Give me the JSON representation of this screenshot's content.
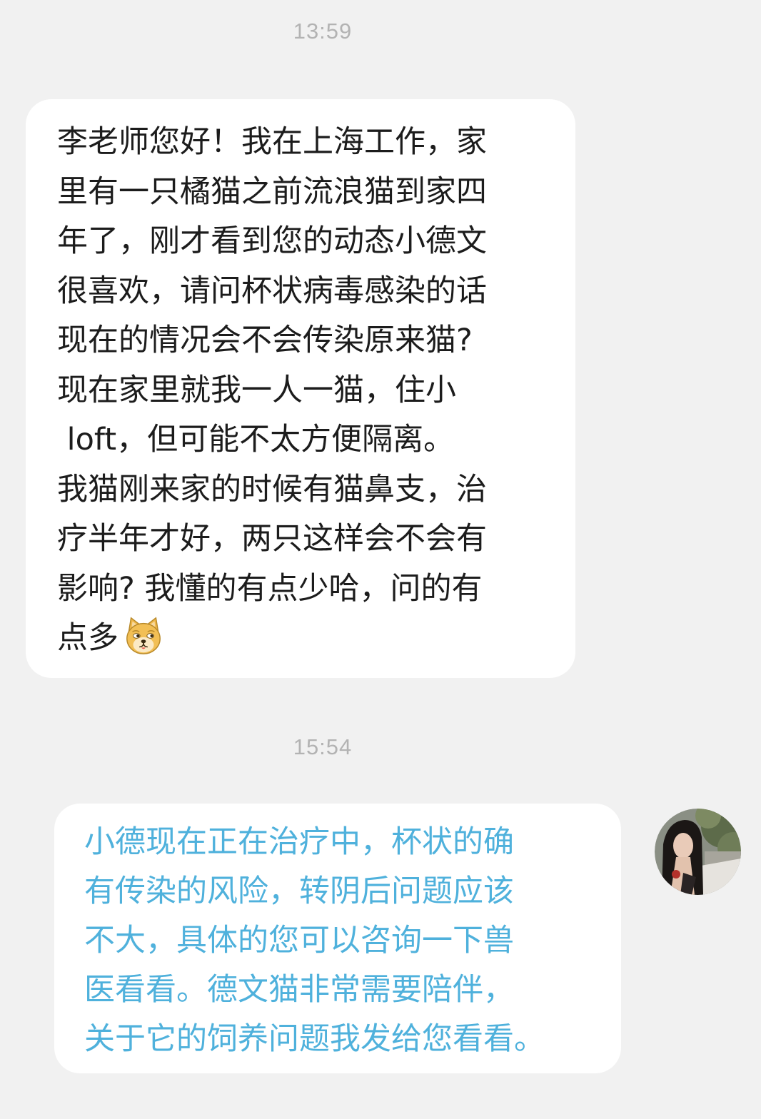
{
  "chat": {
    "messages": [
      {
        "timestamp": "13:59",
        "direction": "incoming",
        "lines": [
          "李老师您好！我在上海工作，家",
          "里有一只橘猫之前流浪猫到家四",
          "年了，刚才看到您的动态小德文",
          "很喜欢，请问杯状病毒感染的话",
          "现在的情况会不会传染原来猫?",
          "现在家里就我一人一猫，住小",
          " loft，但可能不太方便隔离。",
          "我猫刚来家的时候有猫鼻支，治",
          "疗半年才好，两只这样会不会有",
          "影响? 我懂的有点少哈，问的有",
          "点多"
        ],
        "trailing_emoji": "doge-emoji"
      },
      {
        "timestamp": "15:54",
        "direction": "outgoing",
        "lines": [
          "小德现在正在治疗中，杯状的确",
          "有传染的风险，转阴后问题应该",
          "不大，具体的您可以咨询一下兽",
          "医看看。德文猫非常需要陪伴，",
          "关于它的饲养问题我发给您看看。"
        ],
        "avatar": "user-avatar"
      }
    ]
  },
  "colors": {
    "background": "#f1f1f1",
    "bubble": "#ffffff",
    "incoming_text": "#1c1c1c",
    "outgoing_text": "#4fb1dc",
    "timestamp": "#b3b3b3"
  }
}
